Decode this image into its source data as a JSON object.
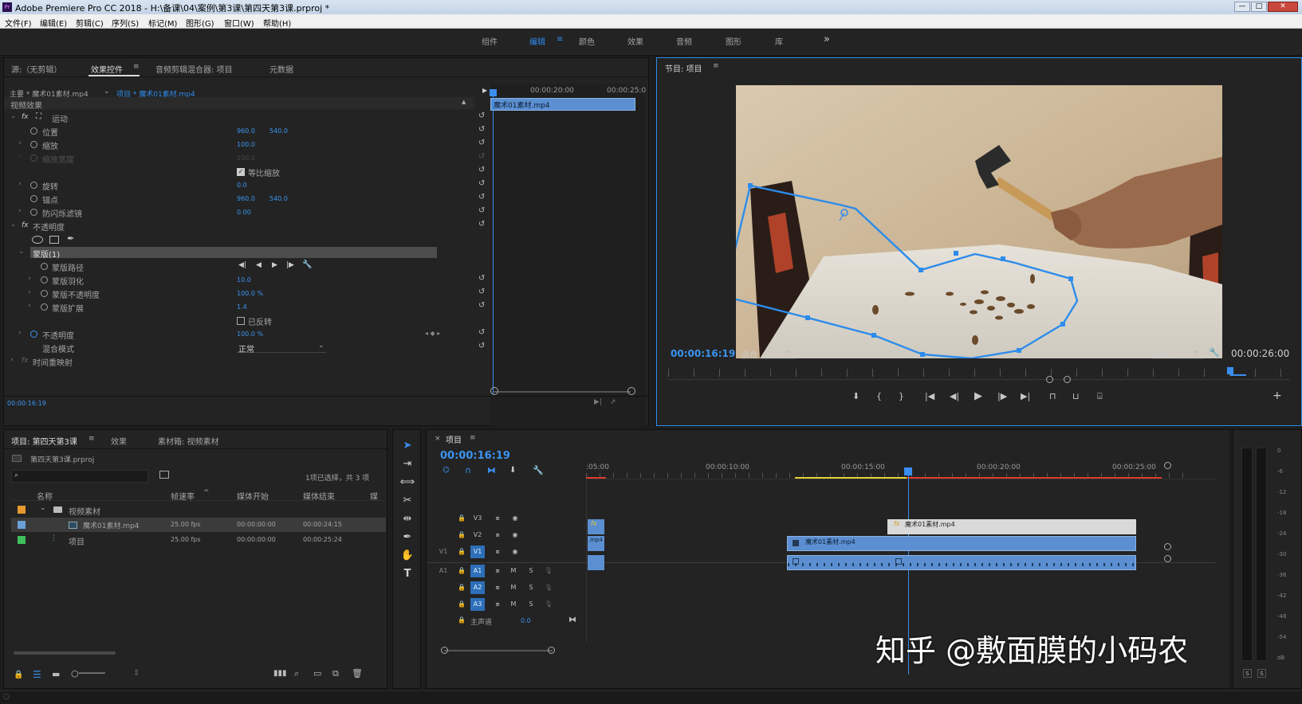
{
  "window": {
    "title": "Adobe Premiere Pro CC 2018 - H:\\备课\\04\\案例\\第3课\\第四天第3课.prproj *"
  },
  "menu": [
    "文件(F)",
    "编辑(E)",
    "剪辑(C)",
    "序列(S)",
    "标记(M)",
    "图形(G)",
    "窗口(W)",
    "帮助(H)"
  ],
  "workspaces": [
    "组件",
    "编辑",
    "颜色",
    "效果",
    "音频",
    "图形",
    "库"
  ],
  "workspace_active": "编辑",
  "workspace_more": "»",
  "source_panel": {
    "tabs": [
      "源:（无剪辑）",
      "效果控件",
      "音频剪辑混合器: 项目",
      "元数据"
    ],
    "active_tab": "效果控件",
    "master_clip": "主要 * 魔术01素材.mp4",
    "sequence_clip": "项目 * 魔术01素材.mp4",
    "mini_ruler": [
      "00:00:20:00",
      "00:00:25:0"
    ],
    "mini_clip": "魔术01素材.mp4",
    "section": "视频效果",
    "rows": [
      {
        "name": "运动",
        "fx": true
      },
      {
        "name": "位置",
        "v1": "960.0",
        "v2": "540.0"
      },
      {
        "name": "缩放",
        "v1": "100.0"
      },
      {
        "name": "缩放宽度",
        "v1": "100.0",
        "disabled": true
      },
      {
        "name": "等比缩放",
        "checkbox": true,
        "checked": true
      },
      {
        "name": "旋转",
        "v1": "0.0"
      },
      {
        "name": "锚点",
        "v1": "960.0",
        "v2": "540.0"
      },
      {
        "name": "防闪烁滤镜",
        "v1": "0.00"
      },
      {
        "name": "不透明度",
        "fx": true
      },
      {
        "name": "mask-tools"
      },
      {
        "name": "蒙版(1)",
        "selected": true
      },
      {
        "name": "蒙版路径",
        "track": true
      },
      {
        "name": "蒙版羽化",
        "v1": "10.0"
      },
      {
        "name": "蒙版不透明度",
        "v1": "100.0 %"
      },
      {
        "name": "蒙版扩展",
        "v1": "1.4"
      },
      {
        "name": "已反转",
        "checkbox": true,
        "checked": false
      },
      {
        "name": "不透明度",
        "v1": "100.0 %",
        "keyframe": true
      },
      {
        "name": "混合模式",
        "select": "正常"
      },
      {
        "name": "时间重映射"
      }
    ],
    "timecode": "00:00:16:19"
  },
  "program_monitor": {
    "title": "节目: 项目",
    "timecode": "00:00:16:19",
    "fit": "适合",
    "quality": "完整",
    "duration": "00:00:26:00"
  },
  "project_panel": {
    "tabs": [
      "项目: 第四天第3课",
      "效果",
      "素材箱: 视频素材"
    ],
    "file": "第四天第3课.prproj",
    "selection": "1项已选择，共 3 项",
    "columns": [
      "名称",
      "帧速率",
      "媒体开始",
      "媒体结束",
      "媒"
    ],
    "rows": [
      {
        "name": "视频素材",
        "type": "folder",
        "color": "#e69a2e"
      },
      {
        "name": "魔术01素材.mp4",
        "fps": "25.00 fps",
        "start": "00:00:00:00",
        "end": "00:00:24:15",
        "color": "#6aa0d8"
      },
      {
        "name": "项目",
        "fps": "25.00 fps",
        "start": "00:00:00:00",
        "end": "00:00:25:24",
        "color": "#3fbf5a"
      }
    ]
  },
  "timeline": {
    "title": "项目",
    "timecode": "00:00:16:19",
    "ruler": [
      ":05:00",
      "00:00:10:00",
      "00:00:15:00",
      "00:00:20:00",
      "00:00:25:00"
    ],
    "video_tracks": [
      "V3",
      "V2",
      "V1"
    ],
    "audio_tracks": [
      "A1",
      "A2",
      "A3"
    ],
    "master": "主声道",
    "master_value": "0.0",
    "clips": [
      {
        "label": "fx",
        "track": "V2"
      },
      {
        "label": "魔术01素材.mp4",
        "track": "V2"
      },
      {
        "label": ".mp4",
        "track": "V1"
      },
      {
        "label": "魔术01素材.mp4",
        "track": "V1"
      }
    ]
  },
  "meter_scale": [
    "0",
    "-6",
    "-12",
    "-18",
    "-24",
    "-30",
    "-36",
    "-42",
    "-48",
    "-54",
    "dB"
  ],
  "meter_solo": [
    "S",
    "S"
  ],
  "watermark": "知乎 @敷面膜的小码农"
}
